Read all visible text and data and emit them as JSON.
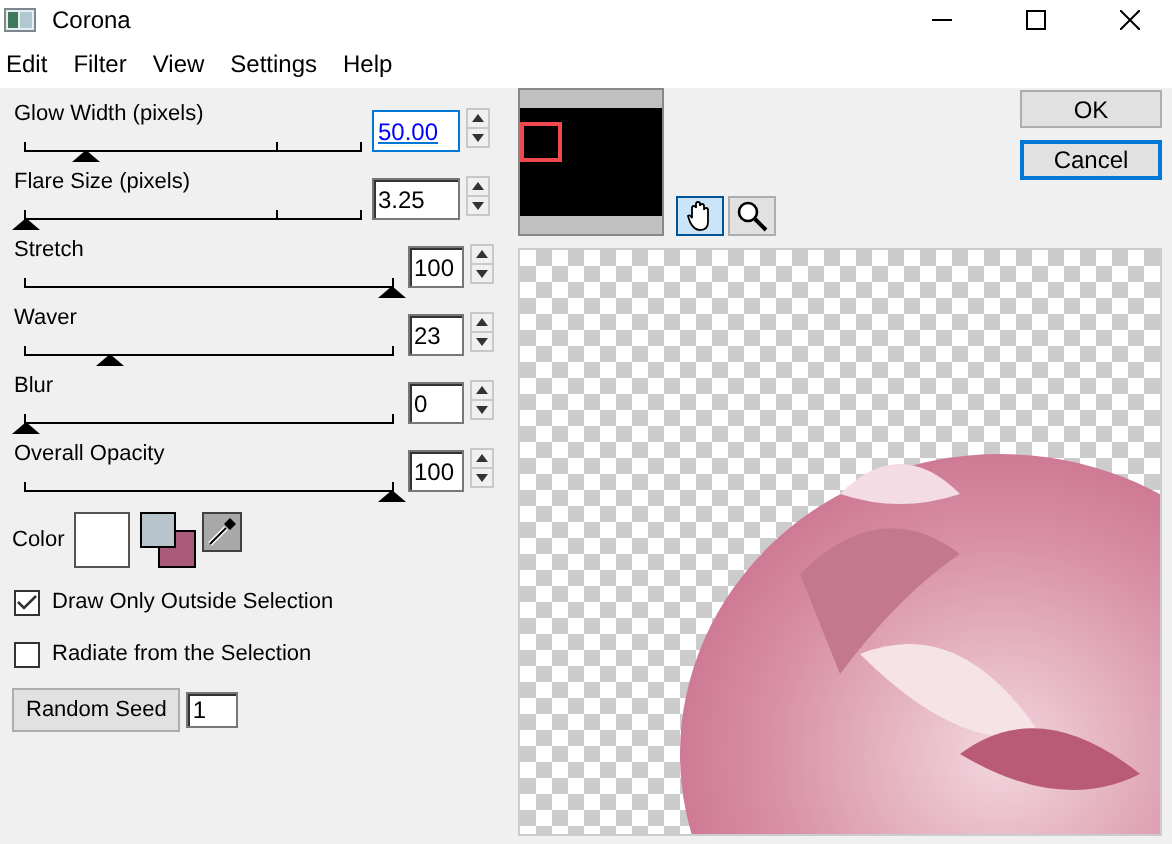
{
  "window": {
    "title": "Corona"
  },
  "menu": [
    "Edit",
    "Filter",
    "View",
    "Settings",
    "Help"
  ],
  "sliders": [
    {
      "label": "Glow Width (pixels)",
      "kind": "ticked",
      "value": "50.00",
      "focused": true,
      "level": 0.18
    },
    {
      "label": "Flare Size (pixels)",
      "kind": "ticked",
      "value": "3.25",
      "focused": false,
      "level": 0
    },
    {
      "label": "Stretch",
      "kind": "plain",
      "value": "100",
      "focused": false,
      "level": 1
    },
    {
      "label": "Waver",
      "kind": "plain",
      "value": "23",
      "focused": false,
      "level": 0.23
    },
    {
      "label": "Blur",
      "kind": "plain",
      "value": "0",
      "focused": false,
      "level": 0
    },
    {
      "label": "Overall Opacity",
      "kind": "plain",
      "value": "100",
      "focused": false,
      "level": 1
    }
  ],
  "color": {
    "label": "Color",
    "swatches": [
      {
        "kind": "main",
        "color": "#ffffff"
      },
      {
        "kind": "foreground",
        "color": "#b8c4cc"
      },
      {
        "kind": "background",
        "color": "#a85a78"
      }
    ]
  },
  "checkboxes": [
    {
      "label": "Draw Only Outside Selection",
      "checked": true
    },
    {
      "label": "Radiate from the Selection",
      "checked": false
    }
  ],
  "seed": {
    "button": "Random Seed",
    "value": "1"
  },
  "tools": [
    {
      "kind": "hand",
      "selected": true
    },
    {
      "kind": "zoom",
      "selected": false
    }
  ],
  "buttons": [
    {
      "label": "OK",
      "default": false
    },
    {
      "label": "Cancel",
      "default": true
    }
  ]
}
